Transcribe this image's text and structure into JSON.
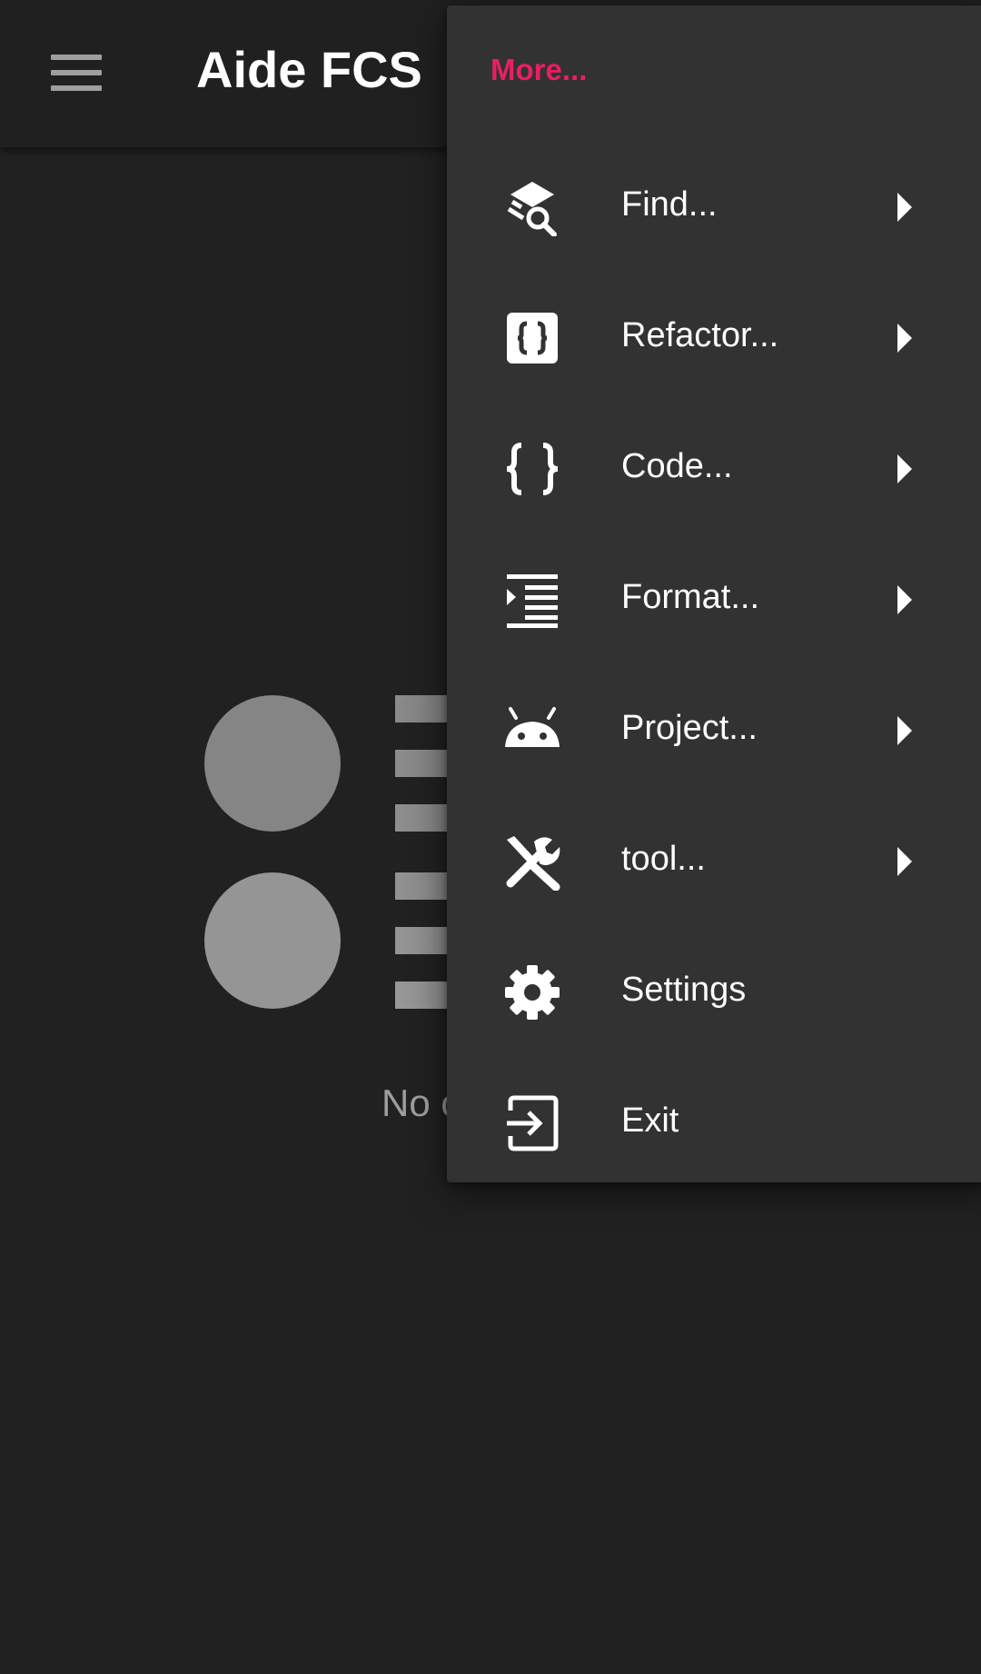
{
  "toolbar": {
    "title": "Aide FCS",
    "menu_icon": "hamburger-menu-icon"
  },
  "empty_state": {
    "message": "No c"
  },
  "menu": {
    "header": "More...",
    "accent_color": "#e91e63",
    "items": [
      {
        "label": "Find...",
        "icon": "find-icon",
        "has_submenu": true
      },
      {
        "label": "Refactor...",
        "icon": "refactor-icon",
        "has_submenu": true
      },
      {
        "label": "Code...",
        "icon": "code-braces-icon",
        "has_submenu": true
      },
      {
        "label": "Format...",
        "icon": "format-indent-icon",
        "has_submenu": true
      },
      {
        "label": "Project...",
        "icon": "android-icon",
        "has_submenu": true
      },
      {
        "label": "tool...",
        "icon": "tools-icon",
        "has_submenu": true
      },
      {
        "label": "Settings",
        "icon": "gear-icon",
        "has_submenu": false
      },
      {
        "label": "Exit",
        "icon": "exit-icon",
        "has_submenu": false
      }
    ]
  }
}
